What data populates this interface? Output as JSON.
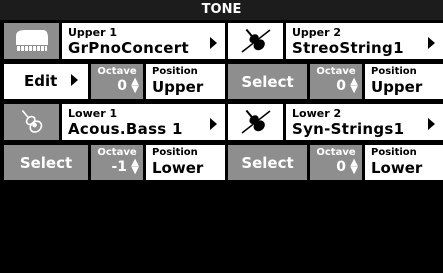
{
  "title": "TONE",
  "parts": [
    {
      "key": "upper1",
      "label": "Upper 1",
      "tone": "GrPnoConcert",
      "icon": "piano-icon",
      "action": "Edit",
      "octave_label": "Octave",
      "octave": "0",
      "position_label": "Position",
      "position": "Upper"
    },
    {
      "key": "upper2",
      "label": "Upper 2",
      "tone": "StreoString1",
      "icon": "violin-icon",
      "action": "Select",
      "octave_label": "Octave",
      "octave": "0",
      "position_label": "Position",
      "position": "Upper"
    },
    {
      "key": "lower1",
      "label": "Lower 1",
      "tone": "Acous.Bass 1",
      "icon": "guitar-icon",
      "action": "Select",
      "octave_label": "Octave",
      "octave": "-1",
      "position_label": "Position",
      "position": "Lower"
    },
    {
      "key": "lower2",
      "label": "Lower 2",
      "tone": "Syn-Strings1",
      "icon": "violin-icon",
      "action": "Select",
      "octave_label": "Octave",
      "octave": "0",
      "position_label": "Position",
      "position": "Lower"
    }
  ],
  "colors": {
    "background": "#000000",
    "tile": "#8e8e8e",
    "panel": "#ffffff",
    "titlebar": "#1c1c1c"
  }
}
